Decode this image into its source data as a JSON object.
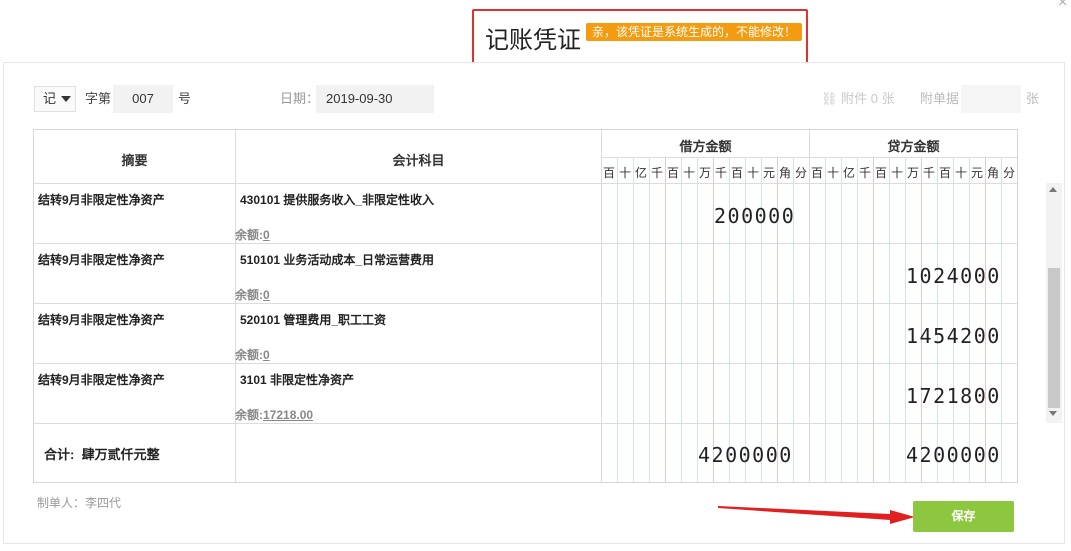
{
  "header": {
    "title": "记账凭证",
    "tip": "亲，该凭证是系统生成的，不能修改！",
    "close_glyph": "×"
  },
  "meta": {
    "word": "记",
    "word_suffix": "字第",
    "number": "007",
    "number_suffix": "号",
    "date_label": "日期：",
    "date": "2019-09-30",
    "attachment_label": "附件 0 张",
    "bills_label": "附单据",
    "bills_value": "",
    "bills_unit": "张"
  },
  "table": {
    "col_summary": "摘要",
    "col_subject": "会计科目",
    "col_debit": "借方金额",
    "col_credit": "贷方金额",
    "digit_units": [
      "百",
      "十",
      "亿",
      "千",
      "百",
      "十",
      "万",
      "千",
      "百",
      "十",
      "元",
      "角",
      "分"
    ],
    "rows": [
      {
        "summary": "结转9月非限定性净资产",
        "subject": "430101 提供服务收入_非限定性收入",
        "balance_label": "余额:",
        "balance": "0",
        "debit": "200000",
        "credit": ""
      },
      {
        "summary": "结转9月非限定性净资产",
        "subject": "510101 业务活动成本_日常运营费用",
        "balance_label": "余额:",
        "balance": "0",
        "debit": "",
        "credit": "1024000"
      },
      {
        "summary": "结转9月非限定性净资产",
        "subject": "520101 管理费用_职工工资",
        "balance_label": "余额:",
        "balance": "0",
        "debit": "",
        "credit": "1454200"
      },
      {
        "summary": "结转9月非限定性净资产",
        "subject": "3101 非限定性净资产",
        "balance_label": "余额:",
        "balance": "17218.00",
        "debit": "",
        "credit": "1721800"
      }
    ],
    "total_label": "合计:",
    "total_words": "肆万贰仟元整",
    "total_debit": "4200000",
    "total_credit": "4200000"
  },
  "footer": {
    "maker": "制单人：李四代",
    "save_label": "保存"
  },
  "colors": {
    "accent_green": "#8dc63f",
    "tip_orange": "#f39c12",
    "highlight_red": "#e03030"
  }
}
